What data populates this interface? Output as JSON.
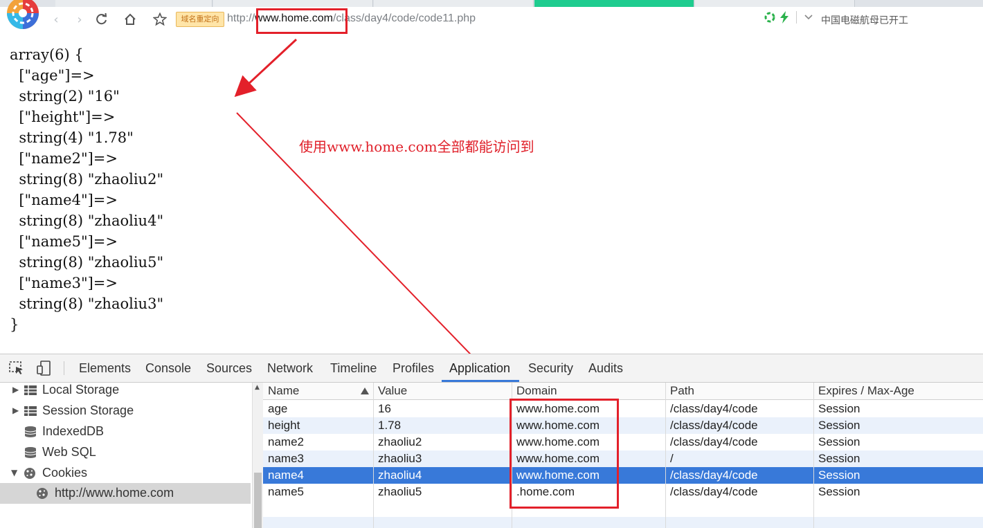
{
  "browser": {
    "redirect_badge": "域名重定向",
    "url_scheme": "http://",
    "url_host": "www.home.com",
    "url_path": "/class/day4/code/code11.php",
    "news_ticker": "中国电磁航母已开工"
  },
  "page": {
    "var_dump": [
      "array(6) {",
      "  [\"age\"]=>",
      "  string(2) \"16\"",
      "  [\"height\"]=>",
      "  string(4) \"1.78\"",
      "  [\"name2\"]=>",
      "  string(8) \"zhaoliu2\"",
      "  [\"name4\"]=>",
      "  string(8) \"zhaoliu4\"",
      "  [\"name5\"]=>",
      "  string(8) \"zhaoliu5\"",
      "  [\"name3\"]=>",
      "  string(8) \"zhaoliu3\"",
      "}"
    ],
    "annotation": "使用www.home.com全部都能访问到"
  },
  "devtools": {
    "tabs": [
      "Elements",
      "Console",
      "Sources",
      "Network",
      "Timeline",
      "Profiles",
      "Application",
      "Security",
      "Audits"
    ],
    "active_tab": "Application",
    "sidebar": {
      "local_storage": "Local Storage",
      "session_storage": "Session Storage",
      "indexeddb": "IndexedDB",
      "web_sql": "Web SQL",
      "cookies": "Cookies",
      "cookie_origin": "http://www.home.com"
    },
    "columns": [
      "Name",
      "Value",
      "Domain",
      "Path",
      "Expires / Max-Age"
    ],
    "cookies": [
      {
        "name": "age",
        "value": "16",
        "domain": "www.home.com",
        "path": "/class/day4/code",
        "expires": "Session"
      },
      {
        "name": "height",
        "value": "1.78",
        "domain": "www.home.com",
        "path": "/class/day4/code",
        "expires": "Session"
      },
      {
        "name": "name2",
        "value": "zhaoliu2",
        "domain": "www.home.com",
        "path": "/class/day4/code",
        "expires": "Session"
      },
      {
        "name": "name3",
        "value": "zhaoliu3",
        "domain": "www.home.com",
        "path": "/",
        "expires": "Session"
      },
      {
        "name": "name4",
        "value": "zhaoliu4",
        "domain": "www.home.com",
        "path": "/class/day4/code",
        "expires": "Session"
      },
      {
        "name": "name5",
        "value": "zhaoliu5",
        "domain": ".home.com",
        "path": "/class/day4/code",
        "expires": "Session"
      }
    ],
    "selected_cookie": "name4"
  },
  "colors": {
    "annotation_red": "#e3202a",
    "selection_blue": "#3879d9",
    "active_tab_green": "#1fcc8f"
  }
}
